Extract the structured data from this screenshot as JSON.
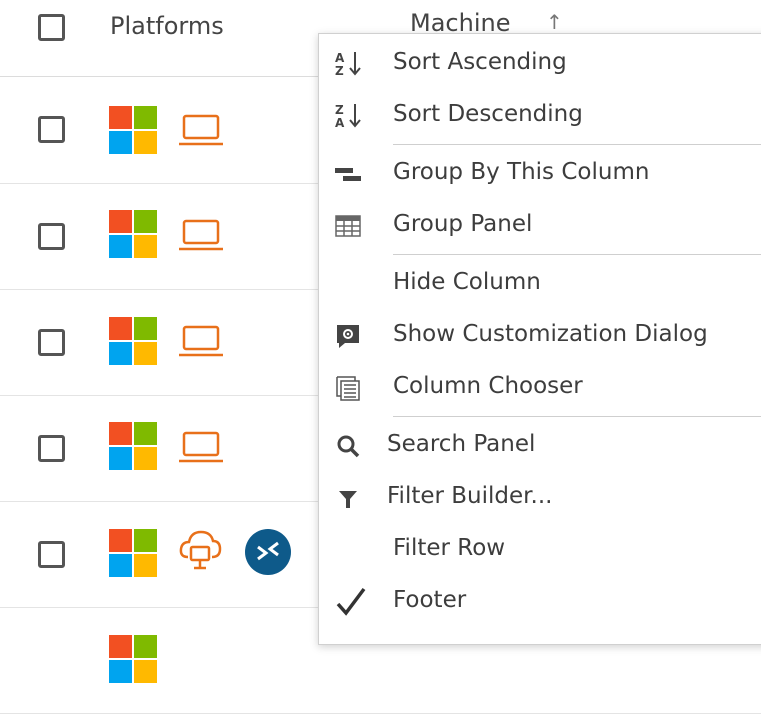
{
  "grid": {
    "columns": {
      "platforms": "Platforms",
      "machine": "Machine"
    },
    "sort_indicator": "↑",
    "rows": [
      {
        "os": "windows-logo",
        "type": "laptop-icon"
      },
      {
        "os": "windows-logo",
        "type": "laptop-icon"
      },
      {
        "os": "windows-logo",
        "type": "laptop-icon"
      },
      {
        "os": "windows-logo",
        "type": "laptop-icon"
      },
      {
        "os": "windows-logo",
        "type": "cloud-desktop-icon",
        "extra": "remote-desktop-icon"
      }
    ]
  },
  "context_menu": {
    "items": [
      {
        "label": "Sort Ascending",
        "icon": "sort-ascending-icon"
      },
      {
        "label": "Sort Descending",
        "icon": "sort-descending-icon"
      },
      {
        "label": "Group By This Column",
        "icon": "group-by-icon"
      },
      {
        "label": "Group Panel",
        "icon": "group-panel-icon"
      },
      {
        "label": "Hide Column",
        "icon": ""
      },
      {
        "label": "Show Customization Dialog",
        "icon": "customization-dialog-icon"
      },
      {
        "label": "Column Chooser",
        "icon": "column-chooser-icon"
      },
      {
        "label": "Search Panel",
        "icon": "search-icon"
      },
      {
        "label": "Filter Builder...",
        "icon": "filter-icon"
      },
      {
        "label": "Filter Row",
        "icon": ""
      },
      {
        "label": "Footer",
        "icon": "checkmark-icon",
        "checked": true
      }
    ]
  },
  "colors": {
    "accent_orange": "#e8701a",
    "rdp_blue": "#0e5a8a"
  }
}
